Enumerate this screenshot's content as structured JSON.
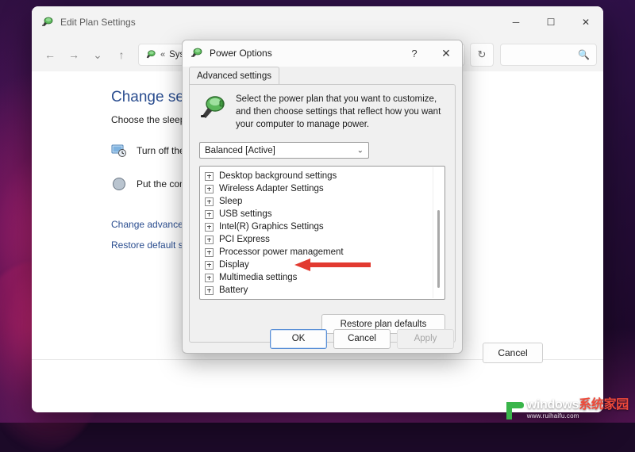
{
  "desktop": {
    "background_colors": [
      "#2a0f3e",
      "#30114a",
      "#d2287a",
      "#1a0725"
    ]
  },
  "explorer_window": {
    "title": "Edit Plan Settings",
    "title_icon": "power-plug-icon",
    "window_controls": {
      "minimize": "─",
      "maximize": "☐",
      "close": "✕"
    },
    "nav": {
      "back": "←",
      "forward": "→",
      "recent": "⌄",
      "up": "↑",
      "refresh": "↻"
    },
    "address_bar": {
      "chevrons": "«",
      "text": "Syste"
    },
    "search": {
      "value": "",
      "placeholder": "",
      "icon": "search-icon"
    },
    "content": {
      "heading": "Change setting",
      "subheading": "Choose the sleep a",
      "rows": [
        {
          "icon": "display-off-icon",
          "label": "Turn off the di"
        },
        {
          "icon": "sleep-icon",
          "label": "Put the comp"
        }
      ],
      "links": [
        "Change advanced",
        "Restore default set"
      ],
      "cancel_label": "Cancel"
    }
  },
  "power_dialog": {
    "title": "Power Options",
    "title_icon": "power-plug-icon",
    "help_label": "?",
    "close_label": "✕",
    "tab": "Advanced settings",
    "intro_icon": "power-plug-large-icon",
    "intro_text": "Select the power plan that you want to customize, and then choose settings that reflect how you want your computer to manage power.",
    "plan_select": {
      "value": "Balanced [Active]",
      "chevron": "⌄"
    },
    "settings_list": [
      "Desktop background settings",
      "Wireless Adapter Settings",
      "Sleep",
      "USB settings",
      "Intel(R) Graphics Settings",
      "PCI Express",
      "Processor power management",
      "Display",
      "Multimedia settings",
      "Battery"
    ],
    "restore_defaults_label": "Restore plan defaults",
    "buttons": {
      "ok": "OK",
      "cancel": "Cancel",
      "apply": "Apply",
      "apply_disabled": true
    }
  },
  "annotation": {
    "type": "arrow-left",
    "color": "#e23a30",
    "points_at": "Multimedia settings"
  },
  "watermark": {
    "brand_en": "windows",
    "brand_cn": "系统家园",
    "url": "www.ruihaifu.com",
    "mark_color": "#39b54a"
  }
}
